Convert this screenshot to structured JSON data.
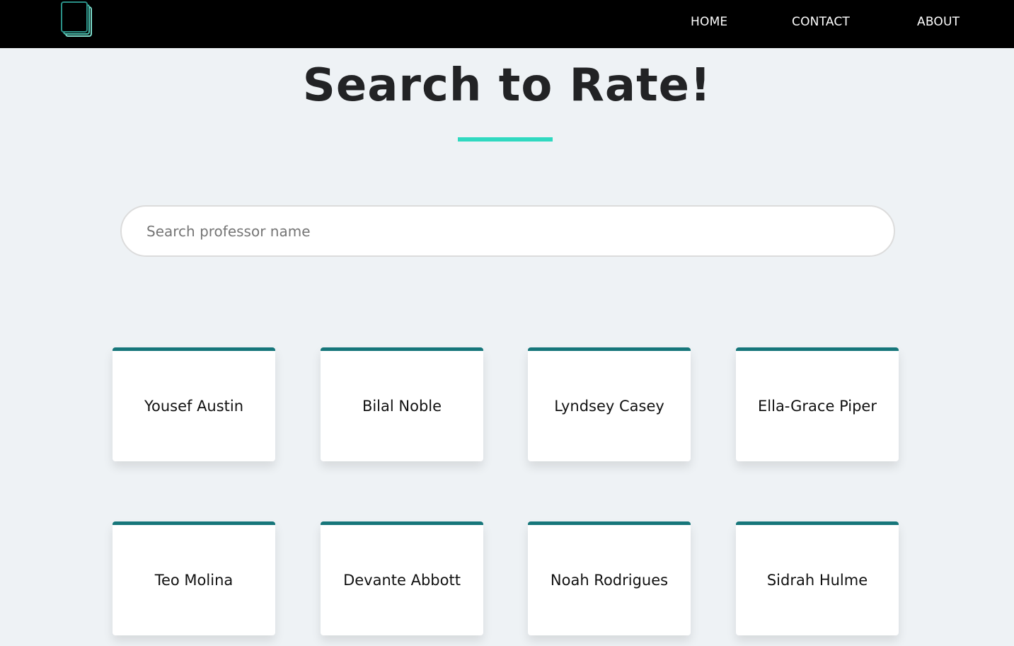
{
  "nav": {
    "logo_icon": "document-stack-icon",
    "links": [
      "HOME",
      "CONTACT",
      "ABOUT"
    ]
  },
  "main": {
    "title": "Search to Rate!",
    "search": {
      "placeholder": "Search professor name",
      "value": ""
    },
    "professors": [
      "Yousef Austin",
      "Bilal Noble",
      "Lyndsey Casey",
      "Ella-Grace Piper",
      "Teo Molina",
      "Devante Abbott",
      "Noah Rodrigues",
      "Sidrah Hulme"
    ]
  },
  "colors": {
    "navbar": "#000000",
    "page_background": "#eef2f5",
    "accent_underline": "#2fd9c0",
    "card_top_border": "#16767a",
    "logo_stroke": "#3fb8a8"
  }
}
